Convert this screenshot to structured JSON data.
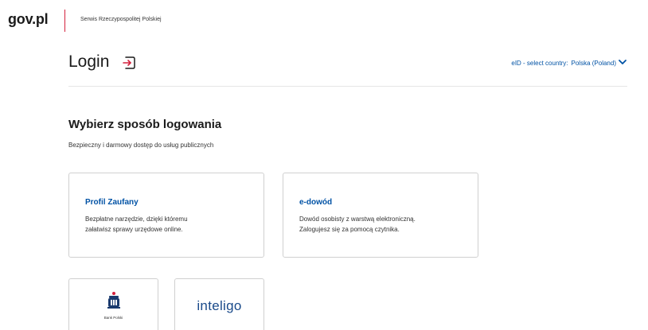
{
  "header": {
    "logo": "gov.pl",
    "subtitle": "Serwis Rzeczypospolitej Polskiej"
  },
  "login": {
    "title": "Login",
    "eid_label": "eID - select country:",
    "eid_country": "Polska (Poland)"
  },
  "main": {
    "heading": "Wybierz sposób logowania",
    "description": "Bezpieczny i darmowy dostęp do usług publicznych"
  },
  "cards": [
    {
      "title": "Profil Zaufany",
      "line1": "Bezpłatne narzędzie, dzięki któremu",
      "line2": "załatwisz sprawy urzędowe online."
    },
    {
      "title": "e-dowód",
      "line1": "Dowód osobisty z warstwą elektroniczną.",
      "line2": "Zalogujesz się za pomocą czytnika."
    }
  ],
  "banks": [
    {
      "name": "Bank Polski"
    },
    {
      "name": "inteligo"
    }
  ],
  "colors": {
    "accent_blue": "#0052a5",
    "gov_red": "#d4213d",
    "text_dark": "#1b1b1b",
    "border": "#d0d0d0"
  }
}
